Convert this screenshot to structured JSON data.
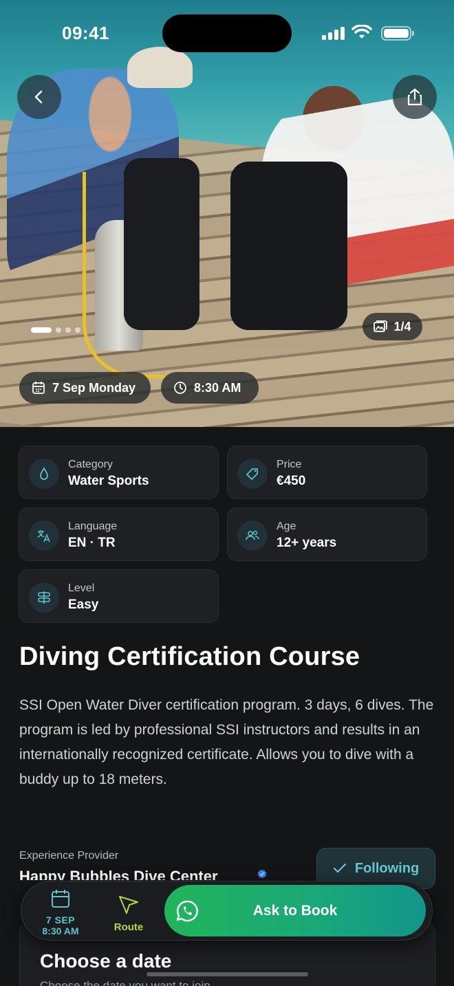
{
  "status_bar": {
    "time": "09:41"
  },
  "hero": {
    "photo_counter": "1/4",
    "carousel": {
      "total": 4,
      "active_index": 0
    },
    "date_pill": "7 Sep Monday",
    "time_pill": "8:30 AM"
  },
  "info": {
    "category": {
      "label": "Category",
      "value": "Water Sports"
    },
    "price": {
      "label": "Price",
      "value": "€450"
    },
    "language": {
      "label": "Language",
      "value": "EN · TR"
    },
    "age": {
      "label": "Age",
      "value": "12+ years"
    },
    "level": {
      "label": "Level",
      "value": "Easy"
    }
  },
  "title": "Diving Certification Course",
  "description": "SSI Open Water Diver certification program. 3 days, 6 dives. The program is led by professional SSI instructors and results in an internationally recognized certificate. Allows you to dive with a buddy up to 18 meters.",
  "provider": {
    "label": "Experience Provider",
    "name": "Happy Bubbles Dive Center",
    "follow_label": "Following"
  },
  "date_section": {
    "title": "Choose a date",
    "subtitle": "Choose the date you want to join"
  },
  "bottom_bar": {
    "date_line1": "7 SEP",
    "date_line2": "8:30 AM",
    "route_label": "Route",
    "book_label": "Ask to Book"
  },
  "colors": {
    "accent_teal": "#5cc6cf",
    "route_green": "#b5d64a",
    "book_gradient_start": "#22b45b",
    "book_gradient_end": "#13958b",
    "verified_blue": "#3b82f6"
  },
  "icons": [
    "back-icon",
    "share-icon",
    "gallery-icon",
    "calendar-icon",
    "clock-icon",
    "drop-icon",
    "tag-icon",
    "translate-icon",
    "people-icon",
    "level-icon",
    "check-icon",
    "verified-icon",
    "whatsapp-icon",
    "navigation-icon"
  ]
}
